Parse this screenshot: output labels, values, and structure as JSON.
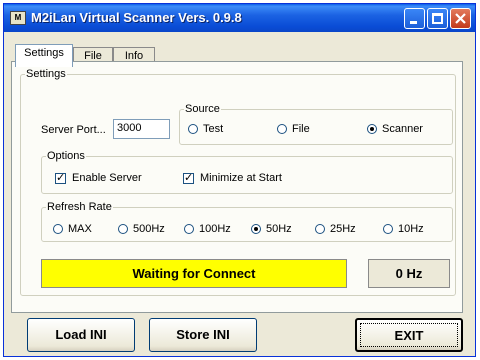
{
  "window": {
    "title": "M2iLan Virtual Scanner  Vers. 0.9.8",
    "icon": "scanner-app-icon",
    "icon_text": "M"
  },
  "tabs": [
    {
      "label": "Settings",
      "active": true
    },
    {
      "label": "File",
      "active": false
    },
    {
      "label": "Info",
      "active": false
    }
  ],
  "settings": {
    "group_label": "Settings",
    "server_port_label": "Server Port...",
    "server_port_value": "3000",
    "source": {
      "label": "Source",
      "options": [
        {
          "label": "Test",
          "selected": false
        },
        {
          "label": "File",
          "selected": false
        },
        {
          "label": "Scanner",
          "selected": true
        }
      ]
    },
    "options": {
      "label": "Options",
      "enable_server": {
        "label": "Enable Server",
        "checked": true
      },
      "minimize_at_start": {
        "label": "Minimize at Start",
        "checked": true
      }
    },
    "refresh_rate": {
      "label": "Refresh Rate",
      "options": [
        {
          "label": "MAX",
          "selected": false
        },
        {
          "label": "500Hz",
          "selected": false
        },
        {
          "label": "100Hz",
          "selected": false
        },
        {
          "label": "50Hz",
          "selected": true
        },
        {
          "label": "25Hz",
          "selected": false
        },
        {
          "label": "10Hz",
          "selected": false
        }
      ]
    }
  },
  "status": {
    "message": "Waiting for Connect",
    "message_color": "#ffff00",
    "rate": "0 Hz"
  },
  "buttons": {
    "load": "Load INI",
    "store": "Store INI",
    "exit": "EXIT"
  }
}
